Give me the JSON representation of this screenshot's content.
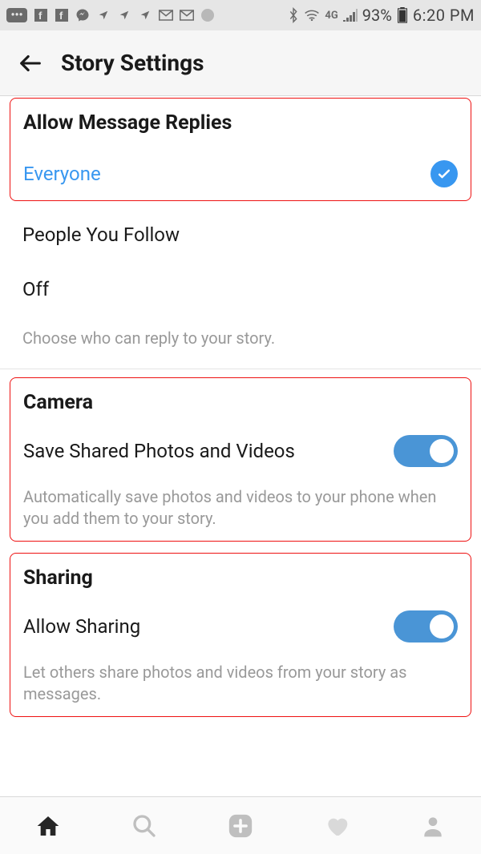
{
  "status_bar": {
    "battery_pct": "93%",
    "time": "6:20 PM",
    "network": "4G"
  },
  "header": {
    "title": "Story Settings"
  },
  "replies": {
    "title": "Allow Message Replies",
    "options": {
      "everyone": "Everyone",
      "people_you_follow": "People You Follow",
      "off": "Off"
    },
    "selected": "everyone",
    "helper": "Choose who can reply to your story."
  },
  "camera": {
    "title": "Camera",
    "toggle_label": "Save Shared Photos and Videos",
    "toggle_on": true,
    "helper": "Automatically save photos and videos to your phone when you add them to your story."
  },
  "sharing": {
    "title": "Sharing",
    "toggle_label": "Allow Sharing",
    "toggle_on": true,
    "helper": "Let others share photos and videos from your story as messages."
  },
  "colors": {
    "accent": "#3897f0",
    "highlight_border": "#e11"
  }
}
